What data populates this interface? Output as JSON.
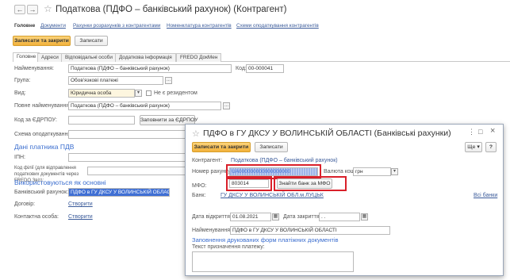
{
  "main": {
    "title": "Податкова (ПДФО – банківський рахунок) (Контрагент)",
    "nav_links": [
      "Головне",
      "Документи",
      "Рахунки розрахунків з контрагентами",
      "Номенклатура контрагентів",
      "Схеми оподаткування контрагентів"
    ],
    "save_close": "Записати та закрити",
    "save": "Записати",
    "tabs": [
      "Головне",
      "Адреси",
      "Відповідальні особи",
      "Додаткова інформація",
      "FREDO ДокМен"
    ],
    "fields": {
      "name_label": "Найменування:",
      "name_value": "Податкова (ПДФО – банківський рахунок)",
      "code_label": "Код:",
      "code_value": "00-000041",
      "group_label": "Група:",
      "group_value": "Обов'язкові платежі",
      "type_label": "Вид:",
      "type_value": "Юридична особа",
      "nonresident_label": "Не є резидентом",
      "fullname_label": "Повне найменування:",
      "fullname_value": "Податкова (ПДФО – банківський рахунок)",
      "edrpou_label": "Код за ЄДРПОУ:",
      "edrpou_button": "Заповнити за ЄДРПОУ",
      "tax_scheme_label": "Схема оподаткування:"
    },
    "vat_section": "Дані платника ПДВ",
    "ipn_label": "ІПН:",
    "branch_label": "Код філії (для відправлення податкових документів через FREDO Звіт):",
    "default_section": "Використовуються як основні",
    "bank_account_label": "Банківський рахунок:",
    "bank_account_value": "ПДФО в ГУ ДКСУ У ВОЛИНСЬКІЙ ОБЛАСТІ",
    "contract_label": "Договір:",
    "contract_link": "Створити",
    "contact_label": "Контактна особа:",
    "contact_link": "Створити"
  },
  "dialog": {
    "title": "ПДФО в ГУ ДКСУ У ВОЛИНСЬКІЙ ОБЛАСТІ (Банківські рахунки)",
    "save_close": "Записати та закрити",
    "save": "Записати",
    "more": "Ще",
    "help": "?",
    "counterparty_label": "Контрагент:",
    "counterparty_value": "Податкова (ПДФО – банківський рахунок)",
    "account_label": "Номер рахунку:",
    "account_value": "UA000000000000000000",
    "currency_label": "Валюта коштів:",
    "currency_value": "грн",
    "mfo_label": "МФО:",
    "mfo_value": "803014",
    "find_bank_button": "Знайти банк за МФО",
    "bank_label": "Банк:",
    "bank_value": "ГУ ДКСУ У ВОЛИНСЬКІЙ ОБЛ.м.ЛУЦЬК",
    "all_banks": "Всі банки",
    "open_date_label": "Дата відкриття:",
    "open_date_value": "01.08.2021",
    "close_date_label": "Дата закриття:",
    "close_date_value": ". .",
    "name_label": "Найменування:",
    "name_value": "ПДФО в ГУ ДКСУ У ВОЛИНСЬКІЙ ОБЛАСТІ",
    "print_section": "Заповнення друкованих форм платіжних документів",
    "purpose_label": "Текст призначення платежу:"
  },
  "icons": {
    "back": "←",
    "forward": "→",
    "star": "☆",
    "dots": "...",
    "dropdown": "▾",
    "calendar": "▦",
    "menu": "⋮",
    "maximize": "□",
    "close": "×"
  },
  "colors": {
    "primary_button": "#f2b13b",
    "link": "#3b5b9a",
    "section_heading": "#3b6ecf",
    "highlight_box": "#d9202a",
    "selection": "#3f6fd4"
  }
}
